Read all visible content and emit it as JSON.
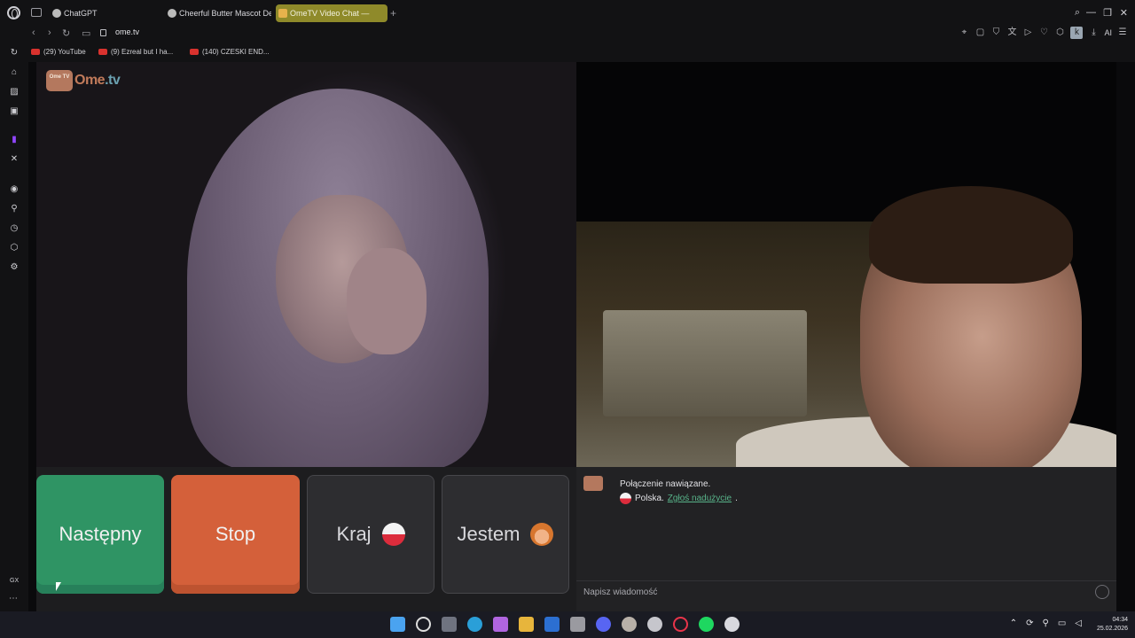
{
  "browser": {
    "tabs": [
      {
        "label": "ChatGPT"
      },
      {
        "label": "Cheerful Butter Mascot De"
      },
      {
        "label": "OmeTV Video Chat —",
        "active": true
      }
    ],
    "url": "ome.tv",
    "bookmarks": [
      {
        "label": "(29) YouTube"
      },
      {
        "label": "(9) Ezreal but I ha..."
      },
      {
        "label": "(140) CZESKI END..."
      }
    ],
    "toolbar_k": "k",
    "toolbar_ai": "AI",
    "active_tab_color": "#8f8a2a"
  },
  "sidebar": {
    "bottom_label": "GX",
    "more": "⋯"
  },
  "site": {
    "logo_text_main": "Ome",
    "logo_text_accent": ".tv",
    "logo_badge": "Ome TV",
    "accent_color": "#2f9464"
  },
  "controls": {
    "next_label": "Następny",
    "stop_label": "Stop",
    "country_label": "Kraj",
    "gender_label": "Jestem",
    "next_color": "#2f9464",
    "stop_color": "#d4603a"
  },
  "chat": {
    "status": "Połączenie nawiązane.",
    "country": "Polska.",
    "report_link": "Zgłoś nadużycie",
    "report_suffix": ".",
    "input_placeholder": "Napisz wiadomość"
  },
  "taskbar": {
    "time": "04:34",
    "date": "25.02.2026"
  }
}
